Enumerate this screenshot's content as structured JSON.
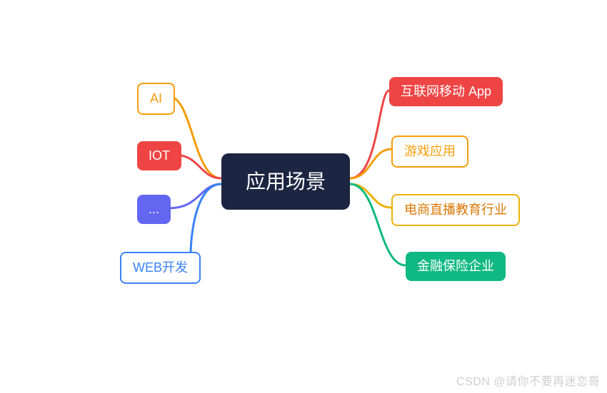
{
  "center": {
    "label": "应用场景"
  },
  "left": [
    {
      "label": "AI",
      "color": "#f59e0b",
      "style": "outline"
    },
    {
      "label": "IOT",
      "color": "#ef4444",
      "style": "filled"
    },
    {
      "label": "...",
      "color": "#6366f1",
      "style": "filled"
    },
    {
      "label": "WEB开发",
      "color": "#3b82f6",
      "style": "outline"
    }
  ],
  "right": [
    {
      "label": "互联网移动 App",
      "color": "#ef4444",
      "style": "filled"
    },
    {
      "label": "游戏应用",
      "color": "#f59e0b",
      "style": "outline"
    },
    {
      "label": "电商直播教育行业",
      "color": "#eab308",
      "style": "outline"
    },
    {
      "label": "金融保险企业",
      "color": "#10b981",
      "style": "filled"
    }
  ],
  "watermark": "CSDN @请你不要再迷恋哥"
}
